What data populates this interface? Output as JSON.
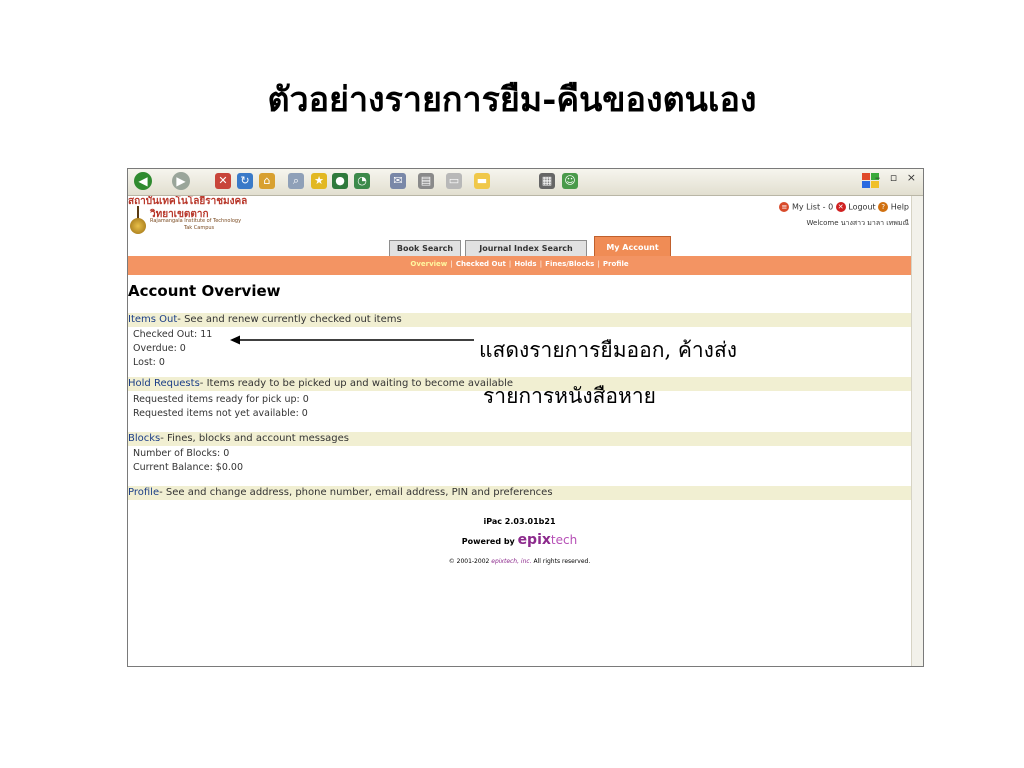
{
  "slide": {
    "title": "ตัวอย่างรายการยืม-คืนของตนเอง",
    "annotation_line1": "แสดงรายการยืมออก, ค้างส่ง",
    "annotation_line2": "รายการหนังสือหาย"
  },
  "browser": {
    "toolbar_icons": [
      "back-icon",
      "forward-icon",
      "stop-icon",
      "refresh-icon",
      "home-icon",
      "search-icon",
      "favorites-icon",
      "media-icon",
      "history-icon",
      "mail-icon",
      "print-icon",
      "edit-icon",
      "folder-icon",
      "calculator-icon",
      "messenger-icon"
    ],
    "window_controls": "– ▫ ×"
  },
  "header": {
    "logo_thai_line1": "สถาบันเทคโนโลยีราชมงคล",
    "logo_thai_line2": "วิทยาเขตตาก",
    "logo_en": "Rajamangala Institute of Technology",
    "logo_campus": "Tak Campus",
    "my_list": "My List - 0",
    "logout": "Logout",
    "help": "Help",
    "welcome": "Welcome นางสาว มาลา เทพมณี"
  },
  "tabs": [
    {
      "label": "Book Search",
      "active": false
    },
    {
      "label": "Journal Index Search",
      "active": false
    },
    {
      "label": "My Account",
      "active": true
    }
  ],
  "subnav": [
    "Overview",
    "Checked Out",
    "Holds",
    "Fines/Blocks",
    "Profile"
  ],
  "page_title": "Account Overview",
  "sections": [
    {
      "name": "Items Out",
      "desc": "- See and renew currently checked out items",
      "lines": [
        "Checked Out: 11",
        "Overdue: 0",
        "Lost: 0"
      ]
    },
    {
      "name": "Hold Requests",
      "desc": "- Items ready to be picked up and waiting to become available",
      "lines": [
        "Requested items ready for pick up: 0",
        "Requested items not yet available: 0"
      ]
    },
    {
      "name": "Blocks",
      "desc": "- Fines, blocks and account messages",
      "lines": [
        "Number of Blocks: 0",
        "Current Balance: $0.00"
      ]
    },
    {
      "name": "Profile",
      "desc": "- See and change address, phone number, email address, PIN and preferences",
      "lines": []
    }
  ],
  "footer": {
    "version": "iPac 2.03.01b21",
    "powered_by": "Powered by",
    "brand_a": "epix",
    "brand_b": "tech",
    "copyright_a": "© 2001-2002 ",
    "copyright_b": "epixtech, inc.",
    "copyright_c": " All rights reserved."
  },
  "colors": {
    "accent": "#f39463",
    "section_bg": "#f1efd2",
    "section_title": "#1a3d87"
  }
}
